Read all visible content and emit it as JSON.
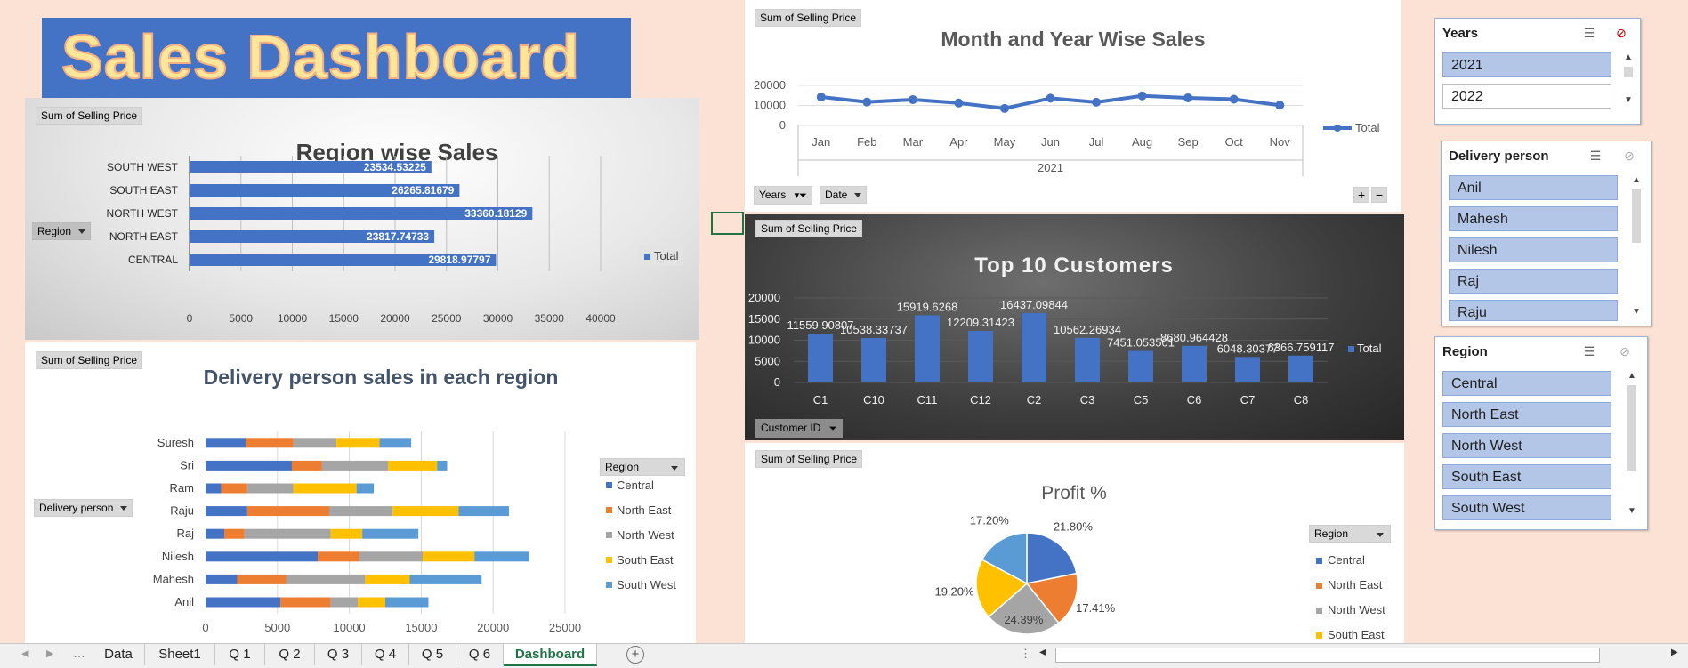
{
  "dashboard_title": "Sales Dashboard",
  "field_button_sum": "Sum of Selling Price",
  "region_chart": {
    "title": "Region wise Sales",
    "axis_button": "Region",
    "legend": "Total",
    "chart_data": {
      "type": "bar",
      "orientation": "horizontal",
      "title": "Region wise Sales",
      "categories": [
        "SOUTH WEST",
        "SOUTH EAST",
        "NORTH WEST",
        "NORTH EAST",
        "CENTRAL"
      ],
      "values": [
        23534.53225,
        26265.81679,
        33360.18129,
        23817.74733,
        29818.97797
      ],
      "labels": [
        "23534.53225",
        "26265.81679",
        "33360.18129",
        "23817.74733",
        "29818.97797"
      ],
      "series": [
        {
          "name": "Total"
        }
      ],
      "xlim": [
        0,
        40000
      ],
      "xticks": [
        "0",
        "5000",
        "10000",
        "15000",
        "20000",
        "25000",
        "30000",
        "35000",
        "40000"
      ],
      "bar_color": "#4472c4"
    }
  },
  "delivery_chart": {
    "title": "Delivery person sales in each region",
    "axis_button": "Delivery person",
    "legend_button": "Region",
    "chart_data": {
      "type": "bar",
      "orientation": "horizontal",
      "stacked": true,
      "title": "Delivery person sales in each region",
      "categories": [
        "Suresh",
        "Sri",
        "Ram",
        "Raju",
        "Raj",
        "Nilesh",
        "Mahesh",
        "Anil"
      ],
      "series": [
        {
          "name": "Central",
          "color": "#4472c4",
          "values": [
            2800,
            6000,
            1100,
            2900,
            1300,
            7800,
            2200,
            5200
          ]
        },
        {
          "name": "North East",
          "color": "#ed7d31",
          "values": [
            3300,
            2100,
            1800,
            5700,
            1400,
            2900,
            3400,
            3500
          ]
        },
        {
          "name": "North West",
          "color": "#a5a5a5",
          "values": [
            3000,
            4600,
            3200,
            4400,
            6000,
            4400,
            5500,
            1900
          ]
        },
        {
          "name": "South East",
          "color": "#ffc000",
          "values": [
            3000,
            3400,
            4400,
            4600,
            2200,
            3600,
            3100,
            1900
          ]
        },
        {
          "name": "South West",
          "color": "#5b9bd5",
          "values": [
            2200,
            700,
            1200,
            3500,
            3900,
            3800,
            5000,
            3000
          ]
        }
      ],
      "xlim": [
        0,
        25000
      ],
      "xticks": [
        "0",
        "5000",
        "10000",
        "15000",
        "20000",
        "25000"
      ]
    }
  },
  "month_chart": {
    "title": "Month and Year Wise Sales",
    "legend": "Total",
    "year_label": "2021",
    "buttons": {
      "years": "Years",
      "date": "Date"
    },
    "chart_data": {
      "type": "line",
      "title": "Month and Year Wise Sales",
      "categories": [
        "Jan",
        "Feb",
        "Mar",
        "Apr",
        "May",
        "Jun",
        "Jul",
        "Aug",
        "Sep",
        "Oct",
        "Nov"
      ],
      "series": [
        {
          "name": "Total",
          "color": "#4472c4",
          "values": [
            14200,
            11700,
            12900,
            11200,
            8500,
            13600,
            11600,
            14800,
            13800,
            13100,
            10100
          ]
        }
      ],
      "ylim": [
        0,
        20000
      ],
      "yticks": [
        "0",
        "10000",
        "20000"
      ]
    }
  },
  "customers_chart": {
    "title": "Top 10 Customers",
    "legend": "Total",
    "button": "Customer ID",
    "chart_data": {
      "type": "bar",
      "title": "Top 10 Customers",
      "categories": [
        "C1",
        "C10",
        "C11",
        "C12",
        "C2",
        "C3",
        "C5",
        "C6",
        "C7",
        "C8"
      ],
      "values": [
        11559.90807,
        10538.33737,
        15919.6268,
        12209.31423,
        16437.09844,
        10562.26934,
        7451.053501,
        8680.964428,
        6048.30377,
        6366.759117
      ],
      "labels": [
        "11559.90807",
        "10538.33737",
        "15919.6268",
        "12209.31423",
        "16437.09844",
        "10562.26934",
        "7451.053501",
        "8680.964428",
        "6048.30377",
        "6366.759117"
      ],
      "series": [
        {
          "name": "Total"
        }
      ],
      "ylim": [
        0,
        20000
      ],
      "yticks": [
        "0",
        "5000",
        "10000",
        "15000",
        "20000"
      ],
      "bar_color": "#4472c4"
    }
  },
  "profit_chart": {
    "title": "Profit %",
    "legend_button": "Region",
    "chart_data": {
      "type": "pie",
      "title": "Profit %",
      "series": [
        {
          "name": "Central",
          "value": 21.8,
          "label": "21.80%",
          "color": "#4472c4"
        },
        {
          "name": "North East",
          "value": 17.41,
          "label": "17.41%",
          "color": "#ed7d31"
        },
        {
          "name": "North West",
          "value": 24.39,
          "label": "24.39%",
          "color": "#a5a5a5"
        },
        {
          "name": "South East",
          "value": 19.2,
          "label": "19.20%",
          "color": "#ffc000"
        },
        {
          "name": "South West",
          "value": 17.2,
          "label": "17.20%",
          "color": "#5b9bd5"
        }
      ],
      "visible_legend": [
        "Central",
        "North East",
        "North West",
        "South East"
      ]
    }
  },
  "slicers": {
    "years": {
      "title": "Years",
      "items": [
        {
          "label": "2021",
          "selected": true
        },
        {
          "label": "2022",
          "selected": false
        }
      ]
    },
    "delivery": {
      "title": "Delivery person",
      "items": [
        "Anil",
        "Mahesh",
        "Nilesh",
        "Raj",
        "Raju"
      ]
    },
    "region": {
      "title": "Region",
      "items": [
        "Central",
        "North East",
        "North West",
        "South East",
        "South West"
      ]
    }
  },
  "sheet_tabs": [
    "Data",
    "Sheet1",
    "Q 1",
    "Q 2",
    "Q 3",
    "Q 4",
    "Q 5",
    "Q 6",
    "Dashboard"
  ],
  "active_tab": "Dashboard"
}
